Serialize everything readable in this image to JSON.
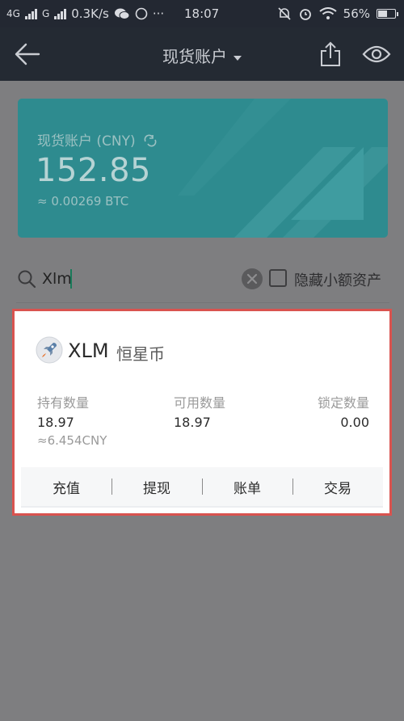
{
  "status_bar": {
    "network1": "4G",
    "network2": "G",
    "speed": "0.3K/s",
    "dots": "···",
    "time": "18:07",
    "battery": "56%"
  },
  "header": {
    "title": "现货账户"
  },
  "account_card": {
    "title": "现货账户 (CNY)",
    "value": "152.85",
    "btc_equiv": "≈ 0.00269 BTC"
  },
  "search": {
    "value": "Xlm",
    "hide_small_label": "隐藏小额资产"
  },
  "asset": {
    "symbol": "XLM",
    "name": "恒星币",
    "holding_label": "持有数量",
    "available_label": "可用数量",
    "locked_label": "锁定数量",
    "holding": "18.97",
    "available": "18.97",
    "locked": "0.00",
    "cny_equiv": "≈6.454CNY"
  },
  "actions": {
    "deposit": "充值",
    "withdraw": "提现",
    "bill": "账单",
    "trade": "交易"
  },
  "colors": {
    "card_bg": "#2e8b8f",
    "header_bg": "#242a33",
    "overlay_bg": "#7e7e80",
    "highlight": "#d9534f"
  }
}
